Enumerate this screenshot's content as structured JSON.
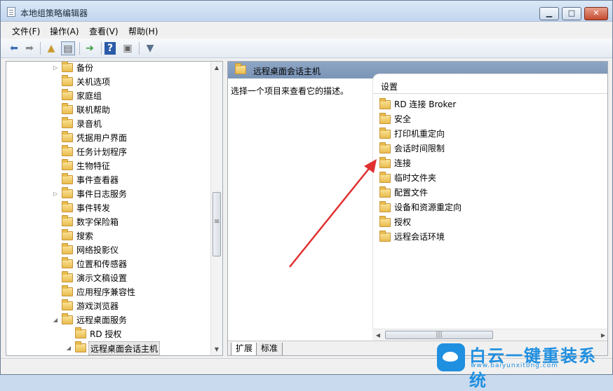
{
  "window": {
    "title": "本地组策略编辑器",
    "minimize": "▁",
    "maximize": "□",
    "close": "✕"
  },
  "menu": [
    "文件(F)",
    "操作(A)",
    "查看(V)",
    "帮助(H)"
  ],
  "toolbar_icons": [
    "back-arrow-icon",
    "forward-arrow-icon",
    "up-folder-icon",
    "show-tree-icon",
    "export-list-icon",
    "help-icon",
    "properties-icon",
    "filter-icon"
  ],
  "tree": [
    {
      "label": "备份",
      "arrow": "▷"
    },
    {
      "label": "关机选项",
      "arrow": ""
    },
    {
      "label": "家庭组",
      "arrow": ""
    },
    {
      "label": "联机帮助",
      "arrow": ""
    },
    {
      "label": "录音机",
      "arrow": ""
    },
    {
      "label": "凭据用户界面",
      "arrow": ""
    },
    {
      "label": "任务计划程序",
      "arrow": ""
    },
    {
      "label": "生物特征",
      "arrow": ""
    },
    {
      "label": "事件查看器",
      "arrow": ""
    },
    {
      "label": "事件日志服务",
      "arrow": "▷"
    },
    {
      "label": "事件转发",
      "arrow": ""
    },
    {
      "label": "数字保险箱",
      "arrow": ""
    },
    {
      "label": "搜索",
      "arrow": ""
    },
    {
      "label": "网络投影仪",
      "arrow": ""
    },
    {
      "label": "位置和传感器",
      "arrow": ""
    },
    {
      "label": "演示文稿设置",
      "arrow": ""
    },
    {
      "label": "应用程序兼容性",
      "arrow": ""
    },
    {
      "label": "游戏浏览器",
      "arrow": ""
    },
    {
      "label": "远程桌面服务",
      "arrow": "◢"
    },
    {
      "label": "RD 授权",
      "arrow": ""
    },
    {
      "label": "远程桌面会话主机",
      "arrow": "◢"
    }
  ],
  "right_header": "远程桌面会话主机",
  "description": "选择一个项目来查看它的描述。",
  "list_column": "设置",
  "settings": [
    "RD 连接 Broker",
    "安全",
    "打印机重定向",
    "会话时间限制",
    "连接",
    "临时文件夹",
    "配置文件",
    "设备和资源重定向",
    "授权",
    "远程会话环境"
  ],
  "tabs": [
    "扩展",
    "标准"
  ],
  "watermark": {
    "title": "白云一键重装系统",
    "url": "www.baiyunxitong.com"
  },
  "colors": {
    "accent": "#1f8fe0",
    "annotation_arrow": "#e03030",
    "header": "#8ea6c4"
  }
}
